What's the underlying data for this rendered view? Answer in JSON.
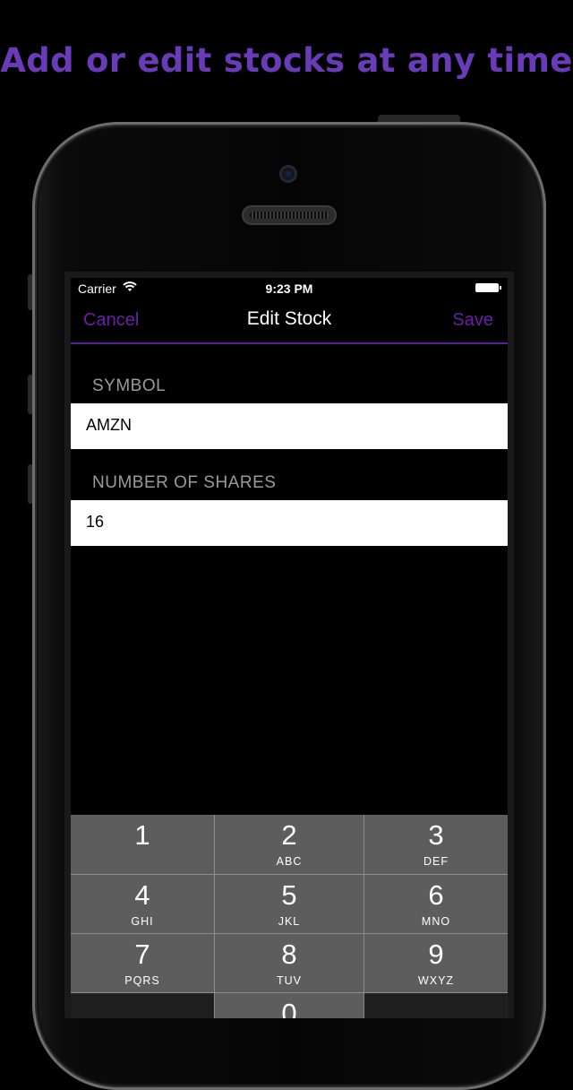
{
  "headline": "Add or edit stocks at any time",
  "status_bar": {
    "carrier": "Carrier",
    "time": "9:23 PM"
  },
  "nav": {
    "cancel": "Cancel",
    "title": "Edit Stock",
    "save": "Save"
  },
  "form": {
    "symbol_label": "SYMBOL",
    "symbol_value": "AMZN",
    "shares_label": "NUMBER OF SHARES",
    "shares_value": "16"
  },
  "keypad": [
    {
      "digit": "1",
      "letters": ""
    },
    {
      "digit": "2",
      "letters": "ABC"
    },
    {
      "digit": "3",
      "letters": "DEF"
    },
    {
      "digit": "4",
      "letters": "GHI"
    },
    {
      "digit": "5",
      "letters": "JKL"
    },
    {
      "digit": "6",
      "letters": "MNO"
    },
    {
      "digit": "7",
      "letters": "PQRS"
    },
    {
      "digit": "8",
      "letters": "TUV"
    },
    {
      "digit": "9",
      "letters": "WXYZ"
    },
    {
      "digit": "",
      "letters": ""
    },
    {
      "digit": "0",
      "letters": ""
    },
    {
      "digit": "",
      "letters": ""
    }
  ],
  "colors": {
    "accent": "#6a1ea8",
    "headline": "#6a3bb8"
  },
  "icons": {
    "wifi": "wifi-icon",
    "battery": "battery-icon"
  }
}
